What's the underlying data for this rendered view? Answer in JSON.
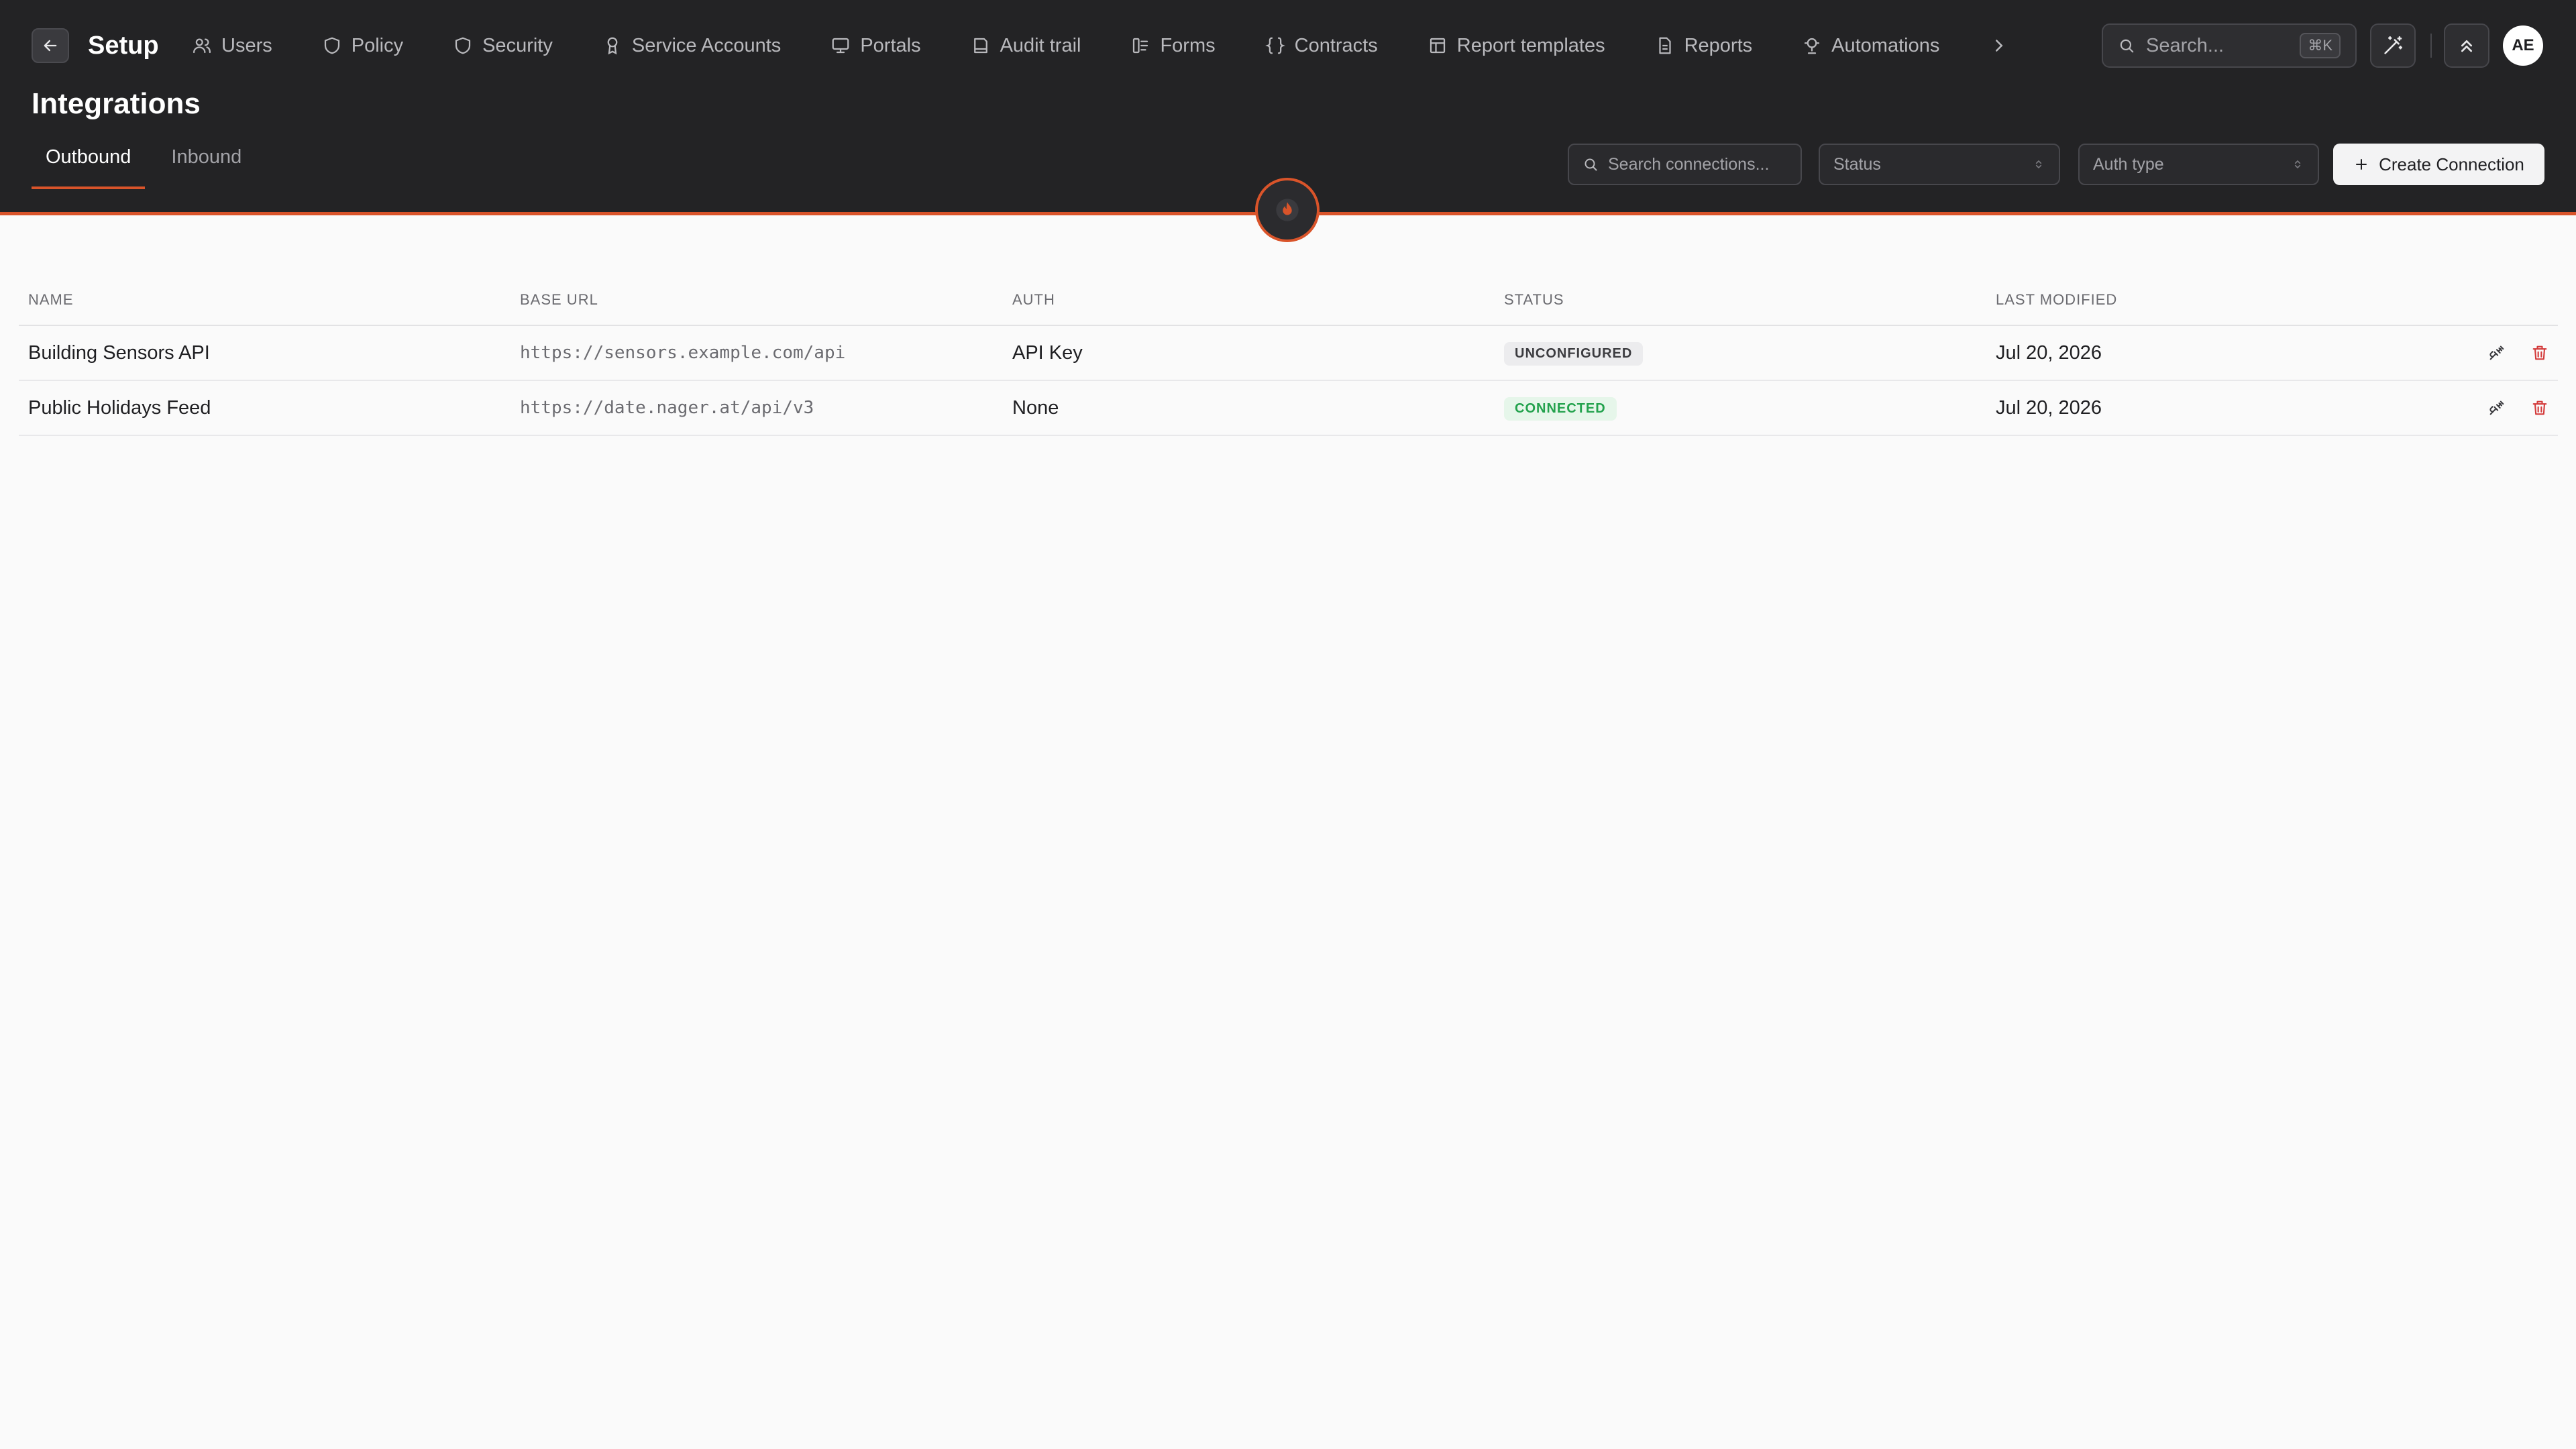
{
  "app": {
    "back_icon": "arrow-left-icon",
    "title": "Setup"
  },
  "nav": {
    "items": [
      {
        "label": "Users",
        "icon": "users-icon"
      },
      {
        "label": "Policy",
        "icon": "shield-icon"
      },
      {
        "label": "Security",
        "icon": "shield-check-icon"
      },
      {
        "label": "Service Accounts",
        "icon": "badge-icon"
      },
      {
        "label": "Portals",
        "icon": "monitor-icon"
      },
      {
        "label": "Audit trail",
        "icon": "book-icon"
      },
      {
        "label": "Forms",
        "icon": "form-icon"
      },
      {
        "label": "Contracts",
        "icon": "braces-icon"
      },
      {
        "label": "Report templates",
        "icon": "template-icon"
      },
      {
        "label": "Reports",
        "icon": "file-icon"
      },
      {
        "label": "Automations",
        "icon": "bot-icon"
      }
    ],
    "more_icon": "chevron-right-icon"
  },
  "global_search": {
    "placeholder": "Search...",
    "shortcut": "⌘K"
  },
  "user": {
    "initials": "AE"
  },
  "page": {
    "title": "Integrations",
    "tabs": [
      {
        "label": "Outbound",
        "active": true
      },
      {
        "label": "Inbound",
        "active": false
      }
    ]
  },
  "toolbar": {
    "search_placeholder": "Search connections...",
    "status_filter": "Status",
    "auth_filter": "Auth type",
    "create_label": "Create Connection"
  },
  "table": {
    "columns": [
      "NAME",
      "BASE URL",
      "AUTH",
      "STATUS",
      "LAST MODIFIED"
    ],
    "rows": [
      {
        "name": "Building Sensors API",
        "base_url": "https://sensors.example.com/api",
        "auth": "API Key",
        "status": "UNCONFIGURED",
        "last_modified": "Jul 20, 2026"
      },
      {
        "name": "Public Holidays Feed",
        "base_url": "https://date.nager.at/api/v3",
        "auth": "None",
        "status": "CONNECTED",
        "last_modified": "Jul 20, 2026"
      }
    ]
  },
  "colors": {
    "header_bg": "#232325",
    "accent": "#d9542a",
    "connected": "#23a24d",
    "delete": "#d33a3a"
  }
}
